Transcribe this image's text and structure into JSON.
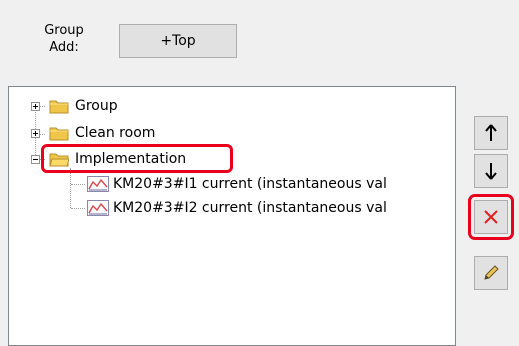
{
  "group_add": {
    "label_line1": "Group",
    "label_line2": "Add:",
    "top_button_label": "+Top"
  },
  "tree": {
    "nodes": [
      {
        "label": "Group",
        "expanded": false
      },
      {
        "label": "Clean room",
        "expanded": false
      },
      {
        "label": "Implementation",
        "expanded": true,
        "highlighted": true,
        "children": [
          {
            "label": "KM20#3#I1 current (instantaneous val"
          },
          {
            "label": "KM20#3#I2 current (instantaneous val"
          }
        ]
      }
    ]
  },
  "side_buttons": [
    {
      "icon": "arrow-up-icon"
    },
    {
      "icon": "arrow-down-icon"
    },
    {
      "icon": "delete-x-icon",
      "highlighted": true
    },
    {
      "icon": "pencil-icon"
    }
  ],
  "colors": {
    "highlight": "#e8001c",
    "delete_icon": "#e02020",
    "folder": "#f0c64a"
  }
}
